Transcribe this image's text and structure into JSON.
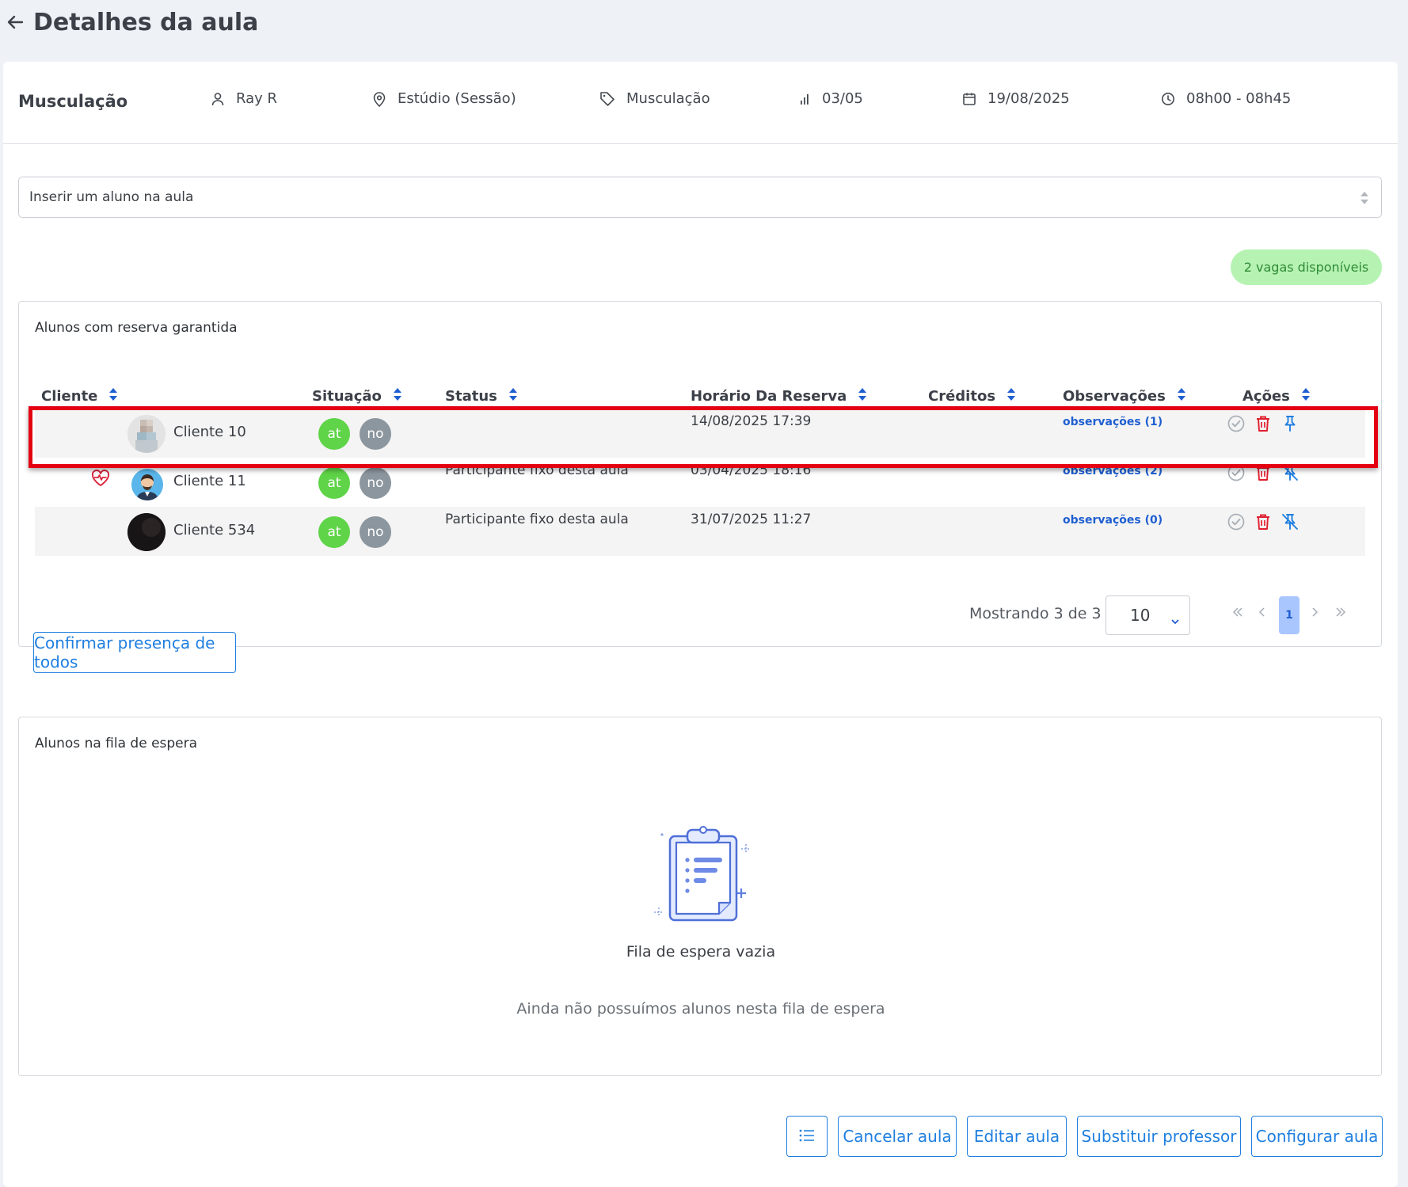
{
  "page": {
    "title": "Detalhes da aula"
  },
  "info": {
    "title": "Musculação",
    "teacher": "Ray R",
    "location": "Estúdio (Sessão)",
    "category": "Musculação",
    "occupancy": "03/05",
    "date": "19/08/2025",
    "time": "08h00 - 08h45"
  },
  "student_select": {
    "placeholder": "Inserir um aluno na aula"
  },
  "vagas": {
    "label": "2 vagas disponíveis"
  },
  "reserved": {
    "title": "Alunos com reserva garantida",
    "columns": [
      "Cliente",
      "Situação",
      "Status",
      "Horário Da Reserva",
      "Créditos",
      "Observações",
      "Ações"
    ],
    "rows": [
      {
        "client": "Cliente 10",
        "sit_a": "at",
        "sit_b": "no",
        "status": "",
        "time": "14/08/2025 17:39",
        "credits": "",
        "obs": "observações (1)",
        "favorite": false,
        "pinned": true
      },
      {
        "client": "Cliente 11",
        "sit_a": "at",
        "sit_b": "no",
        "status": "Participante fixo desta aula",
        "time": "03/04/2025 18:16",
        "credits": "",
        "obs": "observações (2)",
        "favorite": true,
        "pinned": false
      },
      {
        "client": "Cliente 534",
        "sit_a": "at",
        "sit_b": "no",
        "status": "Participante fixo desta aula",
        "time": "31/07/2025 11:27",
        "credits": "",
        "obs": "observações (0)",
        "favorite": false,
        "pinned": false
      }
    ],
    "pager": {
      "showing": "Mostrando 3 de 3",
      "page_size": "10",
      "current_page": "1"
    },
    "confirm_all": "Confirmar presença de todos"
  },
  "waiting": {
    "title": "Alunos na fila de espera",
    "empty_title": "Fila de espera vazia",
    "empty_subtitle": "Ainda não possuímos alunos nesta fila de espera"
  },
  "footer": {
    "cancel": "Cancelar aula",
    "edit": "Editar aula",
    "replace_teacher": "Substituir professor",
    "configure": "Configurar aula"
  },
  "colors": {
    "accent": "#1f7fe0",
    "success": "#5fd448",
    "danger": "#e0202e",
    "highlight": "#e40012"
  }
}
